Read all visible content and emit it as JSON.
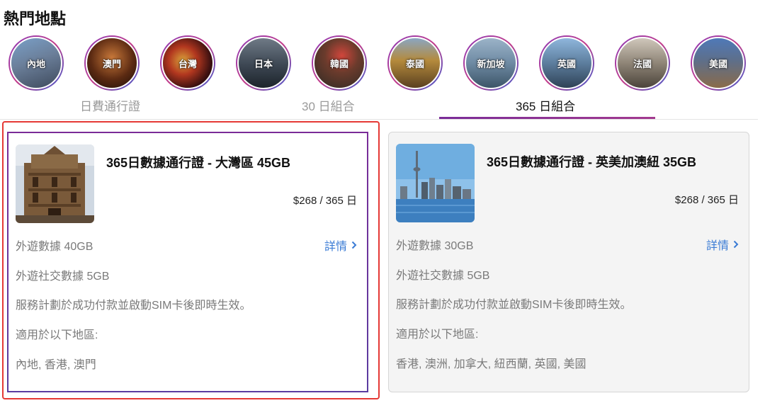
{
  "section_title": "熱門地點",
  "destinations": [
    {
      "label": "內地",
      "icon": "china-photo"
    },
    {
      "label": "澳門",
      "icon": "macau-photo"
    },
    {
      "label": "台灣",
      "icon": "taiwan-photo"
    },
    {
      "label": "日本",
      "icon": "japan-photo"
    },
    {
      "label": "韓國",
      "icon": "korea-photo"
    },
    {
      "label": "泰國",
      "icon": "thailand-photo"
    },
    {
      "label": "新加坡",
      "icon": "singapore-photo"
    },
    {
      "label": "英國",
      "icon": "uk-photo"
    },
    {
      "label": "法國",
      "icon": "france-photo"
    },
    {
      "label": "美國",
      "icon": "usa-photo"
    }
  ],
  "tabs": [
    {
      "label": "日費通行證",
      "active": false
    },
    {
      "label": "30 日組合",
      "active": false
    },
    {
      "label": "365 日組合",
      "active": true
    }
  ],
  "cards": [
    {
      "title": "365日數據通行證 - 大灣區 45GB",
      "price": "$268 / 365 日",
      "details_label": "詳情",
      "data_line": "外遊數據 40GB",
      "social_line": "外遊社交數據 5GB",
      "activation_line": "服務計劃於成功付款並啟動SIM卡後即時生效。",
      "regions_label": "適用於以下地區:",
      "regions": "內地, 香港, 澳門",
      "selected": true
    },
    {
      "title": "365日數據通行證 - 英美加澳紐 35GB",
      "price": "$268 / 365 日",
      "details_label": "詳情",
      "data_line": "外遊數據 30GB",
      "social_line": "外遊社交數據 5GB",
      "activation_line": "服務計劃於成功付款並啟動SIM卡後即時生效。",
      "regions_label": "適用於以下地區:",
      "regions": "香港, 澳洲, 加拿大, 紐西蘭, 英國, 美國",
      "selected": false
    }
  ],
  "colors": {
    "accent_purple": "#7a2c98",
    "link_blue": "#3a7bd5",
    "highlight_red": "#e53935"
  }
}
